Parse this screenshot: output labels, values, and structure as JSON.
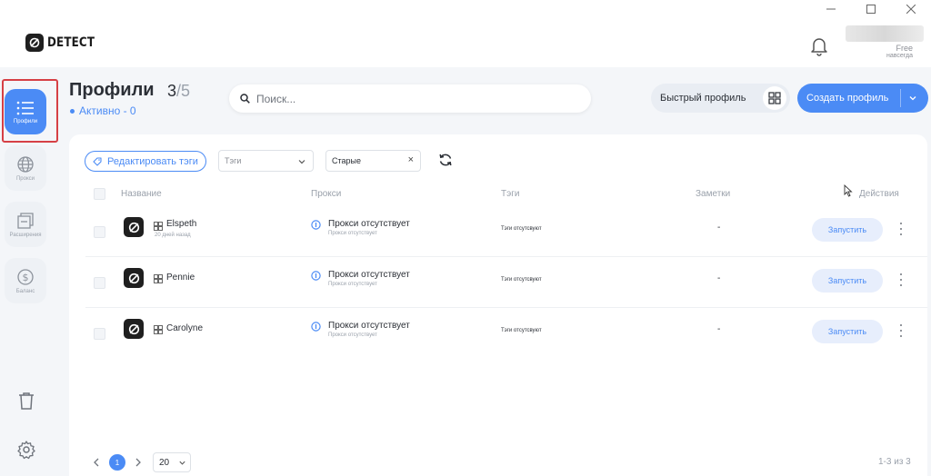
{
  "app": {
    "brand": "DETECT"
  },
  "account": {
    "plan": "Free",
    "period": "навсегда"
  },
  "sidebar": {
    "items": [
      {
        "label": "Профили",
        "icon": "list-icon",
        "active": true
      },
      {
        "label": "Прокси",
        "icon": "globe-icon",
        "active": false
      },
      {
        "label": "Расширения",
        "icon": "extensions-icon",
        "active": false
      },
      {
        "label": "Баланс",
        "icon": "dollar-icon",
        "active": false
      }
    ],
    "bottom": [
      {
        "icon": "trash-icon"
      },
      {
        "icon": "gear-icon"
      }
    ]
  },
  "header": {
    "title": "Профили",
    "count_current": "3",
    "count_total": "/5",
    "active_status": "Активно - 0",
    "search_placeholder": "Поиск...",
    "quick_profile_label": "Быстрый профиль",
    "create_profile_label": "Создать профиль"
  },
  "filters": {
    "edit_tags_label": "Редактировать тэги",
    "tags_placeholder": "Тэги",
    "sort_value": "Старые"
  },
  "table": {
    "columns": [
      "Название",
      "Прокси",
      "Тэги",
      "Заметки",
      "Действия"
    ],
    "rows": [
      {
        "name": "Elspeth",
        "date": "20 дней назад",
        "proxy": "Прокси отсутствует",
        "proxy_sub": "Прокси отсутствует",
        "tags": "Тэги отсутсвуют",
        "notes": "-",
        "action": "Запустить"
      },
      {
        "name": "Pennie",
        "date": "",
        "proxy": "Прокси отсутствует",
        "proxy_sub": "Прокси отсутствует",
        "tags": "Тэги отсутсвуют",
        "notes": "-",
        "action": "Запустить"
      },
      {
        "name": "Carolyne",
        "date": "",
        "proxy": "Прокси отсутствует",
        "proxy_sub": "Прокси отсутствует",
        "tags": "Тэги отсутсвуют",
        "notes": "-",
        "action": "Запустить"
      }
    ]
  },
  "pagination": {
    "current": "1",
    "page_size": "20",
    "range": "1-3 из 3"
  },
  "colors": {
    "accent": "#4b8bf5",
    "highlight": "#d64045",
    "background": "#f4f6f9"
  }
}
